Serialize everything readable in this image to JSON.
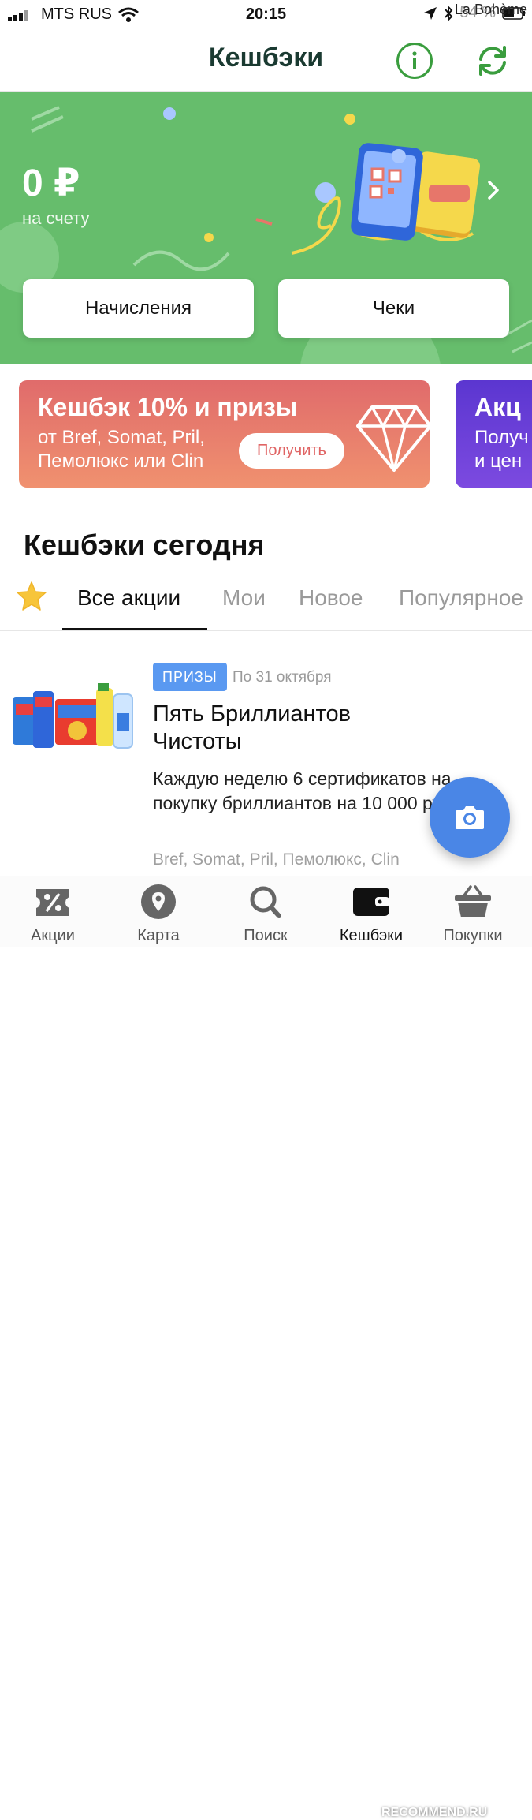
{
  "status_bar": {
    "carrier": "MTS RUS",
    "time": "20:15",
    "battery": "54 %",
    "watermark": "La Bohème"
  },
  "header": {
    "title": "Кешбэки",
    "info_icon": "info-icon",
    "refresh_icon": "refresh-icon"
  },
  "balance_banner": {
    "amount": "0 ₽",
    "subtitle": "на счету",
    "accruals_label": "Начисления",
    "receipts_label": "Чеки",
    "color": "#66bd6c"
  },
  "promos": [
    {
      "title": "Кешбэк 10% и призы",
      "subtitle_line1": "от Bref, Somat, Pril,",
      "subtitle_line2": "Пемолюкс или Clin",
      "button": "Получить"
    },
    {
      "title": "Акц",
      "subtitle_line1": "Получ",
      "subtitle_line2": "и цен"
    }
  ],
  "section": {
    "title": "Кешбэки сегодня"
  },
  "tabs": [
    "Все акции",
    "Мои",
    "Новое",
    "Популярное"
  ],
  "active_tab": "Все акции",
  "offer_card": {
    "badge": "ПРИЗЫ",
    "date": "По 31 октября",
    "title": "Пять Бриллиантов Чистоты",
    "description": "Каждую неделю 6 сертификатов на покупку бриллиантов на 10 000 рублей*",
    "brands": "Bref, Somat, Pril, Пемолюкс, Clin"
  },
  "tab_bar": [
    {
      "label": "Акции",
      "icon": "coupon-percent-icon"
    },
    {
      "label": "Карта",
      "icon": "map-pin-icon"
    },
    {
      "label": "Поиск",
      "icon": "search-icon"
    },
    {
      "label": "Кешбэки",
      "icon": "wallet-icon"
    },
    {
      "label": "Покупки",
      "icon": "basket-icon"
    }
  ],
  "bottom_watermark": "RECOMMEND.RU"
}
